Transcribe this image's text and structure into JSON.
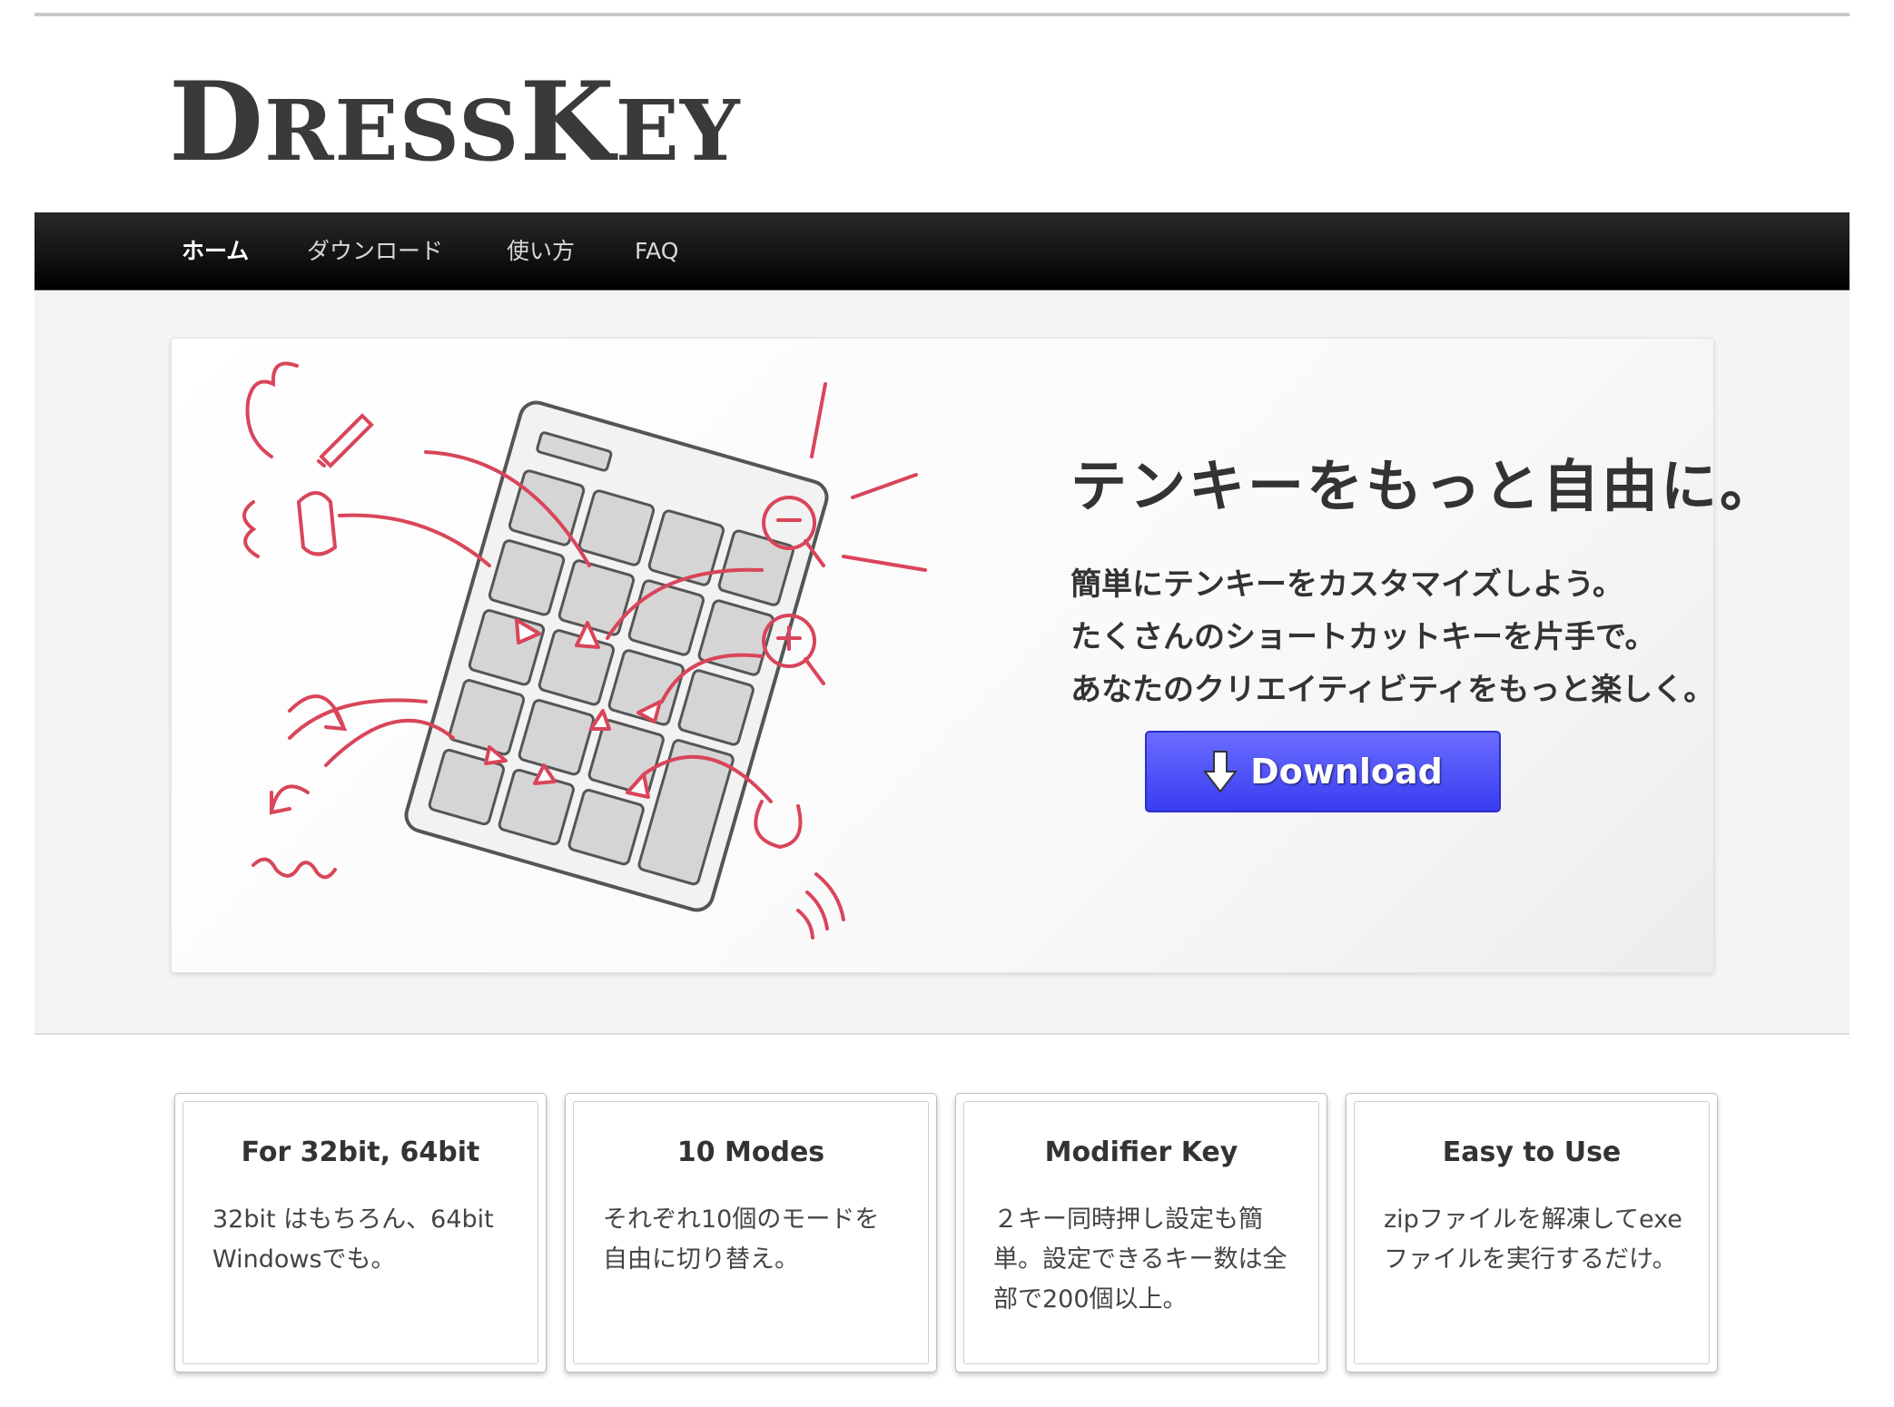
{
  "header": {
    "logo_text_first": "D",
    "logo_text_mid": "RESS",
    "logo_text_k": "K",
    "logo_text_end": "EY"
  },
  "nav": {
    "items": [
      {
        "label": "ホーム",
        "active": true
      },
      {
        "label": "ダウンロード",
        "active": false
      },
      {
        "label": "使い方",
        "active": false
      },
      {
        "label": "FAQ",
        "active": false
      }
    ]
  },
  "hero": {
    "title": "テンキーをもっと自由に。",
    "lines": [
      "簡単にテンキーをカスタマイズしよう。",
      "たくさんのショートカットキーを片手で。",
      "あなたのクリエイティビティをもっと楽しく。"
    ],
    "download_label": "Download",
    "colors": {
      "accent_red": "#d9455a",
      "button_blue": "#4447f5"
    }
  },
  "features": [
    {
      "title": "For 32bit, 64bit",
      "desc": "32bit はもちろん、64bit Windowsでも。"
    },
    {
      "title": "10 Modes",
      "desc": "それぞれ10個のモードを自由に切り替え。"
    },
    {
      "title": "Modifier Key",
      "desc": "２キー同時押し設定も簡単。設定できるキー数は全部で200個以上。"
    },
    {
      "title": "Easy to Use",
      "desc": "zipファイルを解凍してexeファイルを実行するだけ。"
    }
  ]
}
